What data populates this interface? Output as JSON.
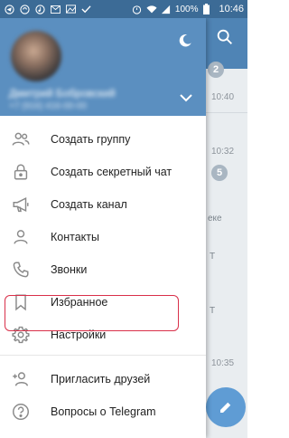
{
  "status_bar": {
    "battery": "100%",
    "time": "10:46"
  },
  "background_chat": {
    "badges": [
      "2",
      "5"
    ],
    "times": [
      "10:40",
      "10:32",
      "10:35"
    ],
    "snippets": [
      "еке",
      "T",
      "T"
    ]
  },
  "drawer": {
    "user_name": "Дмитрий Бобровский",
    "user_phone": "+7 (916) 416-00-00",
    "menu": [
      {
        "label": "Создать группу",
        "icon": "group-icon"
      },
      {
        "label": "Создать секретный чат",
        "icon": "lock-icon"
      },
      {
        "label": "Создать канал",
        "icon": "megaphone-icon"
      },
      {
        "label": "Контакты",
        "icon": "person-icon"
      },
      {
        "label": "Звонки",
        "icon": "phone-icon"
      },
      {
        "label": "Избранное",
        "icon": "bookmark-icon"
      },
      {
        "label": "Настройки",
        "icon": "gear-icon"
      },
      {
        "label": "Пригласить друзей",
        "icon": "add-person-icon"
      },
      {
        "label": "Вопросы о Telegram",
        "icon": "question-icon"
      }
    ]
  },
  "colors": {
    "header": "#5b8fc0",
    "status_bar": "#3c6b96",
    "highlight": "#d9304a",
    "fab": "#5f9cd4"
  }
}
